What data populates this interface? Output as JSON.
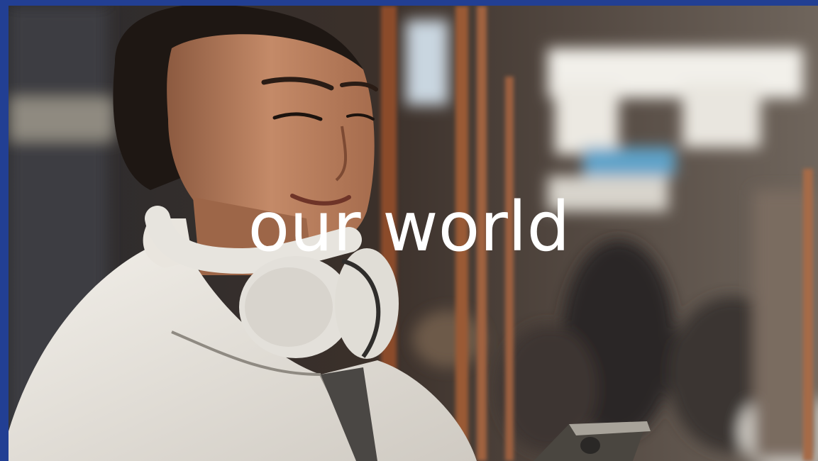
{
  "scene": {
    "headline": "our world",
    "frame_color": "#223f93"
  }
}
